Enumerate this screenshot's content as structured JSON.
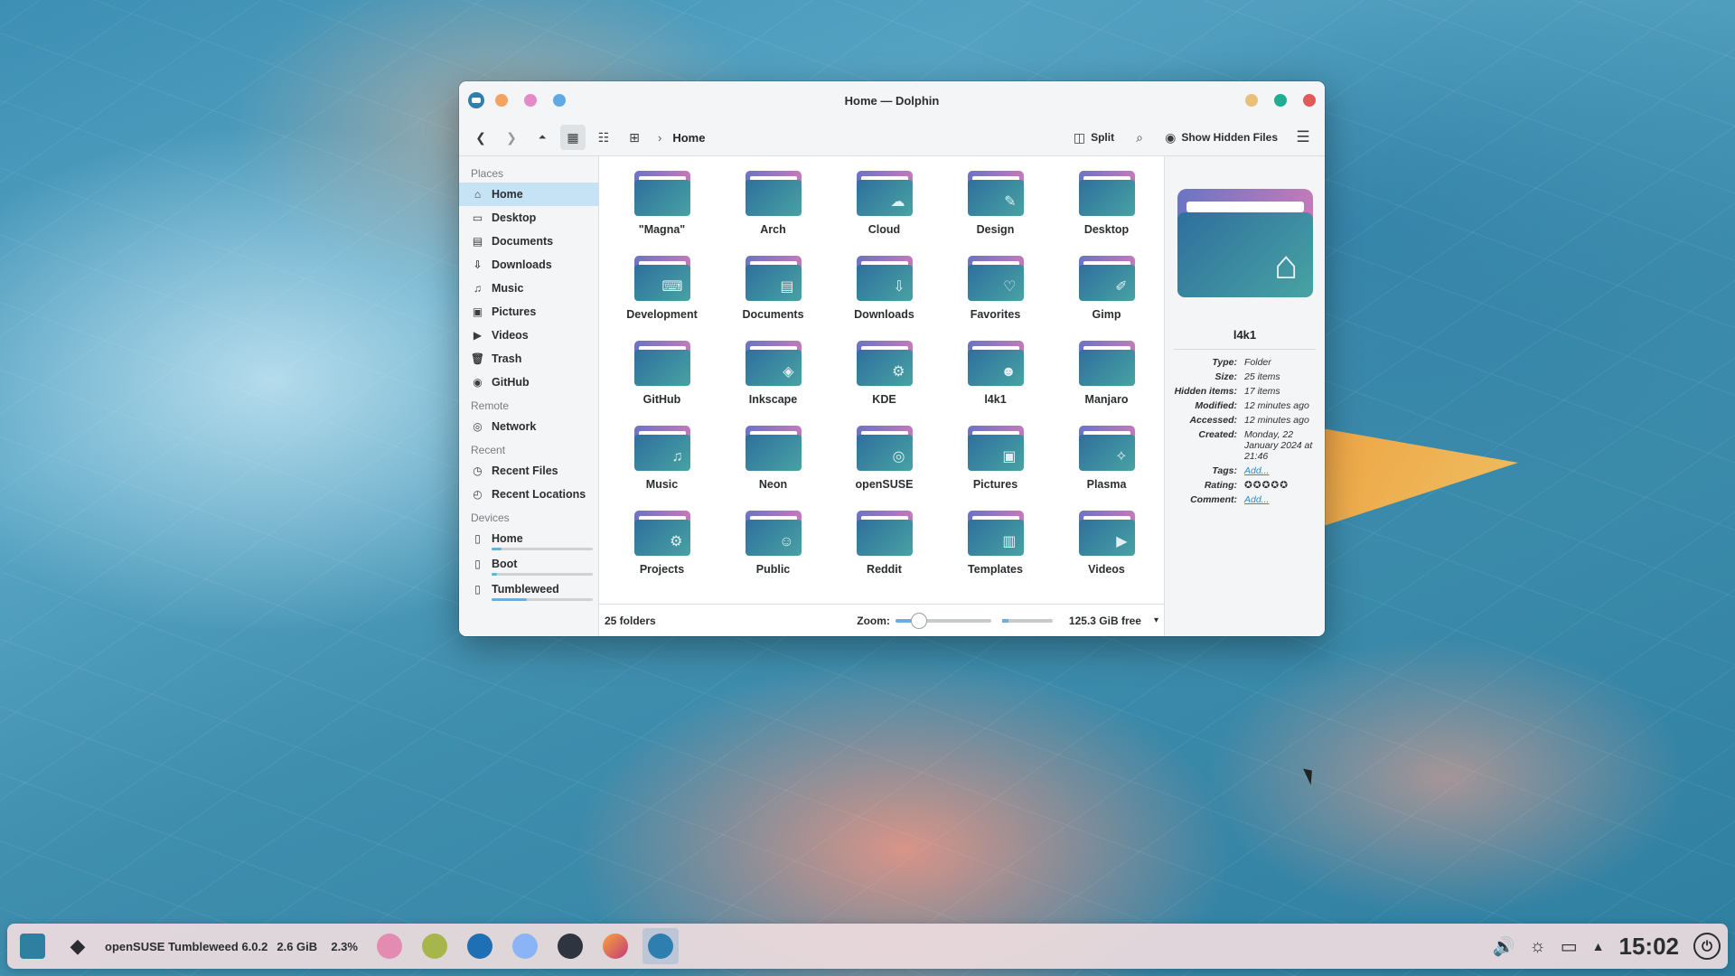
{
  "window": {
    "title": "Home — Dolphin",
    "breadcrumb": "Home",
    "split_label": "Split",
    "hidden_files_label": "Show Hidden Files"
  },
  "sidebar": {
    "places_header": "Places",
    "places": [
      {
        "label": "Home",
        "icon": "home-icon",
        "selected": true
      },
      {
        "label": "Desktop",
        "icon": "desktop-icon"
      },
      {
        "label": "Documents",
        "icon": "documents-icon"
      },
      {
        "label": "Downloads",
        "icon": "downloads-icon"
      },
      {
        "label": "Music",
        "icon": "music-icon"
      },
      {
        "label": "Pictures",
        "icon": "pictures-icon"
      },
      {
        "label": "Videos",
        "icon": "videos-icon"
      },
      {
        "label": "Trash",
        "icon": "trash-icon"
      },
      {
        "label": "GitHub",
        "icon": "github-icon"
      }
    ],
    "remote_header": "Remote",
    "remote": [
      {
        "label": "Network",
        "icon": "network-icon"
      }
    ],
    "recent_header": "Recent",
    "recent": [
      {
        "label": "Recent Files",
        "icon": "recent-files-icon"
      },
      {
        "label": "Recent Locations",
        "icon": "recent-locations-icon"
      }
    ],
    "devices_header": "Devices",
    "devices": [
      {
        "label": "Home",
        "icon": "drive-icon",
        "usage": 0.1
      },
      {
        "label": "Boot",
        "icon": "drive-icon",
        "usage": 0.05
      },
      {
        "label": "Tumbleweed",
        "icon": "drive-icon",
        "usage": 0.35
      }
    ]
  },
  "folders": [
    {
      "name": "\"Magna\"",
      "emblem": ""
    },
    {
      "name": "Arch",
      "emblem": ""
    },
    {
      "name": "Cloud",
      "emblem": "☁"
    },
    {
      "name": "Design",
      "emblem": "✎"
    },
    {
      "name": "Desktop",
      "emblem": ""
    },
    {
      "name": "Development",
      "emblem": "⌨"
    },
    {
      "name": "Documents",
      "emblem": "▤"
    },
    {
      "name": "Downloads",
      "emblem": "⇩"
    },
    {
      "name": "Favorites",
      "emblem": "♡"
    },
    {
      "name": "Gimp",
      "emblem": "✐"
    },
    {
      "name": "GitHub",
      "emblem": ""
    },
    {
      "name": "Inkscape",
      "emblem": "◈"
    },
    {
      "name": "KDE",
      "emblem": "⚙"
    },
    {
      "name": "l4k1",
      "emblem": "☻"
    },
    {
      "name": "Manjaro",
      "emblem": ""
    },
    {
      "name": "Music",
      "emblem": "♫"
    },
    {
      "name": "Neon",
      "emblem": ""
    },
    {
      "name": "openSUSE",
      "emblem": "◎"
    },
    {
      "name": "Pictures",
      "emblem": "▣"
    },
    {
      "name": "Plasma",
      "emblem": "✧"
    },
    {
      "name": "Projects",
      "emblem": "⚙"
    },
    {
      "name": "Public",
      "emblem": "☺"
    },
    {
      "name": "Reddit",
      "emblem": ""
    },
    {
      "name": "Templates",
      "emblem": "▥"
    },
    {
      "name": "Videos",
      "emblem": "▶"
    }
  ],
  "status": {
    "count": "25 folders",
    "zoom_label": "Zoom:",
    "zoom_level": 0.25,
    "free_space": "125.3 GiB free",
    "free_space_used": 0.12
  },
  "info": {
    "name": "l4k1",
    "props": [
      {
        "k": "Type:",
        "v": "Folder"
      },
      {
        "k": "Size:",
        "v": "25 items"
      },
      {
        "k": "Hidden items:",
        "v": "17 items"
      },
      {
        "k": "Modified:",
        "v": "12 minutes ago"
      },
      {
        "k": "Accessed:",
        "v": "12 minutes ago"
      },
      {
        "k": "Created:",
        "v": "Monday, 22 January 2024 at 21:46"
      },
      {
        "k": "Tags:",
        "v": "Add...",
        "link": true
      },
      {
        "k": "Rating:",
        "v": "✪✪✪✪✪",
        "stars": true
      },
      {
        "k": "Comment:",
        "v": "Add...",
        "link": true
      }
    ]
  },
  "taskbar": {
    "distro": "openSUSE Tumbleweed 6.0.2",
    "memory": "2.6 GiB",
    "cpu": "2.3%",
    "clock": "15:02"
  },
  "colors": {
    "accent": "#2d8ad0",
    "selection": "#c5e3f5",
    "dot_orange": "#f4a261",
    "dot_pink": "#e48ac9",
    "dot_blue": "#5fa9e6",
    "btn_yellow": "#e8c07a",
    "btn_green": "#1fae8f",
    "btn_red": "#e05a5a"
  }
}
